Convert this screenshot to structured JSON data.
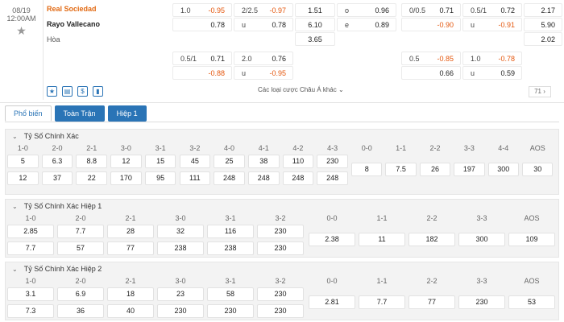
{
  "match": {
    "date": "08/19",
    "time": "12:00AM",
    "home": "Real Sociedad",
    "away": "Rayo Vallecano",
    "draw_label": "Hòa",
    "more_label": "Các loại cược Châu Á khác",
    "count": "71",
    "row1": [
      {
        "l": "1.0",
        "v": "-0.95",
        "neg": true
      },
      {
        "l": "2/2.5",
        "v": "-0.97",
        "neg": true
      },
      {
        "l": "",
        "v": "1.51",
        "neg": false
      },
      {
        "l": "o",
        "v": "0.96",
        "neg": false
      },
      {
        "l": "0/0.5",
        "v": "0.71",
        "neg": false
      },
      {
        "l": "0.5/1",
        "v": "0.72",
        "neg": false
      },
      {
        "l": "",
        "v": "2.17",
        "neg": false
      }
    ],
    "row2": [
      {
        "l": "",
        "v": "0.78",
        "neg": false
      },
      {
        "l": "u",
        "v": "0.78",
        "neg": false
      },
      {
        "l": "",
        "v": "6.10",
        "neg": false
      },
      {
        "l": "e",
        "v": "0.89",
        "neg": false
      },
      {
        "l": "",
        "v": "-0.90",
        "neg": true
      },
      {
        "l": "u",
        "v": "-0.91",
        "neg": true
      },
      {
        "l": "",
        "v": "5.90",
        "neg": false
      }
    ],
    "row3": [
      {
        "l": "",
        "v": "3.65",
        "neg": false
      },
      {
        "l": "",
        "v": "2.02",
        "neg": false
      }
    ],
    "row4": [
      {
        "l": "0.5/1",
        "v": "0.71",
        "neg": false
      },
      {
        "l": "2.0",
        "v": "0.76",
        "neg": false
      },
      {
        "l": "0.5",
        "v": "-0.85",
        "neg": true
      },
      {
        "l": "1.0",
        "v": "-0.78",
        "neg": true
      }
    ],
    "row5": [
      {
        "l": "",
        "v": "-0.88",
        "neg": true
      },
      {
        "l": "u",
        "v": "-0.95",
        "neg": true
      },
      {
        "l": "",
        "v": "0.66",
        "neg": false
      },
      {
        "l": "u",
        "v": "0.59",
        "neg": false
      }
    ]
  },
  "tabs": [
    "Phổ biến",
    "Toàn Trận",
    "Hiệp 1"
  ],
  "sections": [
    {
      "title": "Tỷ Số Chính Xác",
      "home_labels": [
        "1-0",
        "2-0",
        "2-1",
        "3-0",
        "3-1",
        "3-2",
        "4-0",
        "4-1",
        "4-2",
        "4-3"
      ],
      "home_values": [
        "5",
        "6.3",
        "8.8",
        "12",
        "15",
        "45",
        "25",
        "38",
        "110",
        "230"
      ],
      "away_values": [
        "12",
        "37",
        "22",
        "170",
        "95",
        "111",
        "248",
        "248",
        "248",
        "248"
      ],
      "draw_labels": [
        "0-0",
        "1-1",
        "2-2",
        "3-3",
        "4-4",
        "AOS"
      ],
      "draw_values": [
        "8",
        "7.5",
        "26",
        "197",
        "300",
        "30"
      ]
    },
    {
      "title": "Tỷ Số Chính Xác Hiệp 1",
      "home_labels": [
        "1-0",
        "2-0",
        "2-1",
        "3-0",
        "3-1",
        "3-2"
      ],
      "home_values": [
        "2.85",
        "7.7",
        "28",
        "32",
        "116",
        "230"
      ],
      "away_values": [
        "7.7",
        "57",
        "77",
        "238",
        "238",
        "230"
      ],
      "draw_labels": [
        "0-0",
        "1-1",
        "2-2",
        "3-3",
        "AOS"
      ],
      "draw_values": [
        "2.38",
        "11",
        "182",
        "300",
        "109"
      ]
    },
    {
      "title": "Tỷ Số Chính Xác Hiệp 2",
      "home_labels": [
        "1-0",
        "2-0",
        "2-1",
        "3-0",
        "3-1",
        "3-2"
      ],
      "home_values": [
        "3.1",
        "6.9",
        "18",
        "23",
        "58",
        "230"
      ],
      "away_values": [
        "7.3",
        "36",
        "40",
        "230",
        "230",
        "230"
      ],
      "draw_labels": [
        "0-0",
        "1-1",
        "2-2",
        "3-3",
        "AOS"
      ],
      "draw_values": [
        "2.81",
        "7.7",
        "77",
        "230",
        "53"
      ]
    }
  ],
  "colors": {
    "accent": "#2a74b6",
    "home": "#e26a13",
    "negative": "#e4570e"
  }
}
